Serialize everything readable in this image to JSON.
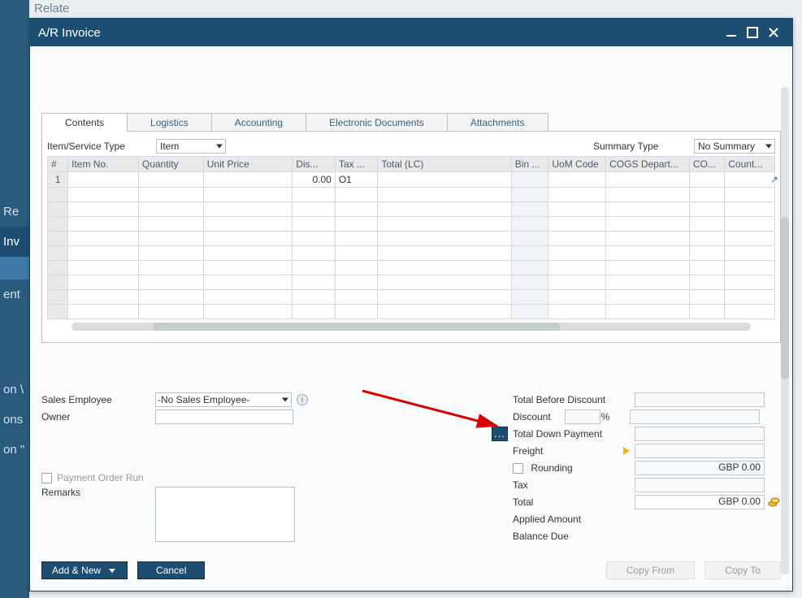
{
  "bg": {
    "top_label": "Relate",
    "side_items": [
      "Re",
      "Inv",
      "",
      "ent",
      "",
      "on \\",
      "ons",
      "on \""
    ]
  },
  "window": {
    "title": "A/R Invoice"
  },
  "tabs": {
    "items": [
      {
        "label": "Contents",
        "active": true
      },
      {
        "label": "Logistics",
        "active": false
      },
      {
        "label": "Accounting",
        "active": false
      },
      {
        "label": "Electronic Documents",
        "active": false
      },
      {
        "label": "Attachments",
        "active": false
      }
    ]
  },
  "contents": {
    "item_service_type_label": "Item/Service Type",
    "item_service_type_value": "Item",
    "summary_type_label": "Summary Type",
    "summary_type_value": "No Summary",
    "columns": [
      "#",
      "Item No.",
      "Quantity",
      "Unit Price",
      "Dis...",
      "Tax ...",
      "Total (LC)",
      "Bin ...",
      "UoM Code",
      "COGS Depart...",
      "CO...",
      "Count..."
    ],
    "rows": [
      {
        "num": "1",
        "item_no": "",
        "quantity": "",
        "unit_price": "",
        "discount": "0.00",
        "tax": "O1",
        "total": "",
        "bin": "",
        "uom": "",
        "cogs": "",
        "co": "",
        "count": ""
      }
    ],
    "empty_rows": 9
  },
  "lower_left": {
    "sales_employee_label": "Sales Employee",
    "sales_employee_value": "-No Sales Employee-",
    "owner_label": "Owner",
    "owner_value": "",
    "payment_order_run_label": "Payment Order Run",
    "remarks_label": "Remarks",
    "remarks_value": ""
  },
  "totals": {
    "total_before_discount_label": "Total Before Discount",
    "total_before_discount_value": "",
    "discount_label": "Discount",
    "discount_pct": "",
    "pct_symbol": "%",
    "discount_value": "",
    "total_down_payment_label": "Total Down Payment",
    "total_down_payment_value": "",
    "freight_label": "Freight",
    "freight_value": "",
    "rounding_label": "Rounding",
    "rounding_value": "GBP 0.00",
    "tax_label": "Tax",
    "tax_value": "",
    "total_label": "Total",
    "total_value": "GBP 0.00",
    "applied_amount_label": "Applied Amount",
    "applied_amount_value": "",
    "balance_due_label": "Balance Due",
    "balance_due_value": "",
    "dots": "..."
  },
  "buttons": {
    "add_new": "Add & New",
    "cancel": "Cancel",
    "copy_from": "Copy From",
    "copy_to": "Copy To"
  }
}
